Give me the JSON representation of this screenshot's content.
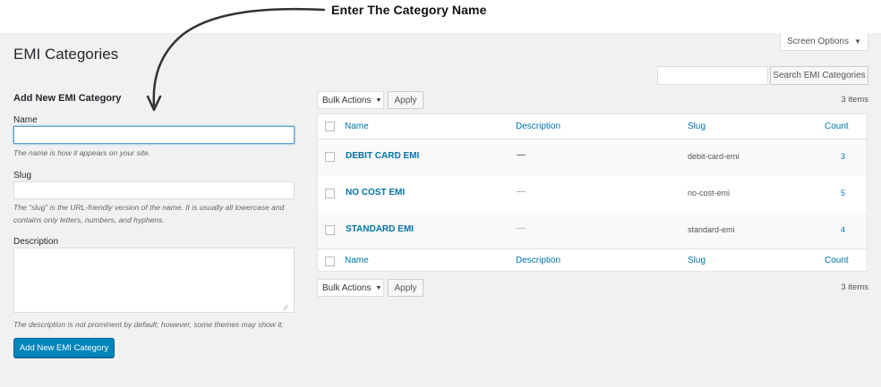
{
  "annotation": {
    "callout": "Enter The Category Name"
  },
  "header": {
    "title": "EMI Categories",
    "screen_options": "Screen Options",
    "search_button": "Search EMI Categories",
    "search_placeholder": ""
  },
  "form": {
    "title": "Add New EMI Category",
    "name_label": "Name",
    "name_value": "",
    "name_help": "The name is how it appears on your site.",
    "slug_label": "Slug",
    "slug_value": "",
    "slug_help": "The “slug” is the URL-friendly version of the name. It is usually all lowercase and contains only letters, numbers, and hyphens.",
    "description_label": "Description",
    "description_value": "",
    "description_help": "The description is not prominent by default; however, some themes may show it.",
    "submit": "Add New EMI Category"
  },
  "bulk": {
    "label": "Bulk Actions",
    "apply": "Apply",
    "items_count": "3 items"
  },
  "table": {
    "columns": [
      "Name",
      "Description",
      "Slug",
      "Count"
    ],
    "rows": [
      {
        "name": "DEBIT CARD EMI",
        "description": "—",
        "slug": "debit-card-emi",
        "count": "3"
      },
      {
        "name": "NO COST EMI",
        "description": "—",
        "slug": "no-cost-emi",
        "count": "5"
      },
      {
        "name": "STANDARD EMI",
        "description": "—",
        "slug": "standard-emi",
        "count": "4"
      }
    ]
  },
  "colors": {
    "primary": "#0085ba",
    "link": "#0073aa",
    "background": "#f1f1f1"
  }
}
